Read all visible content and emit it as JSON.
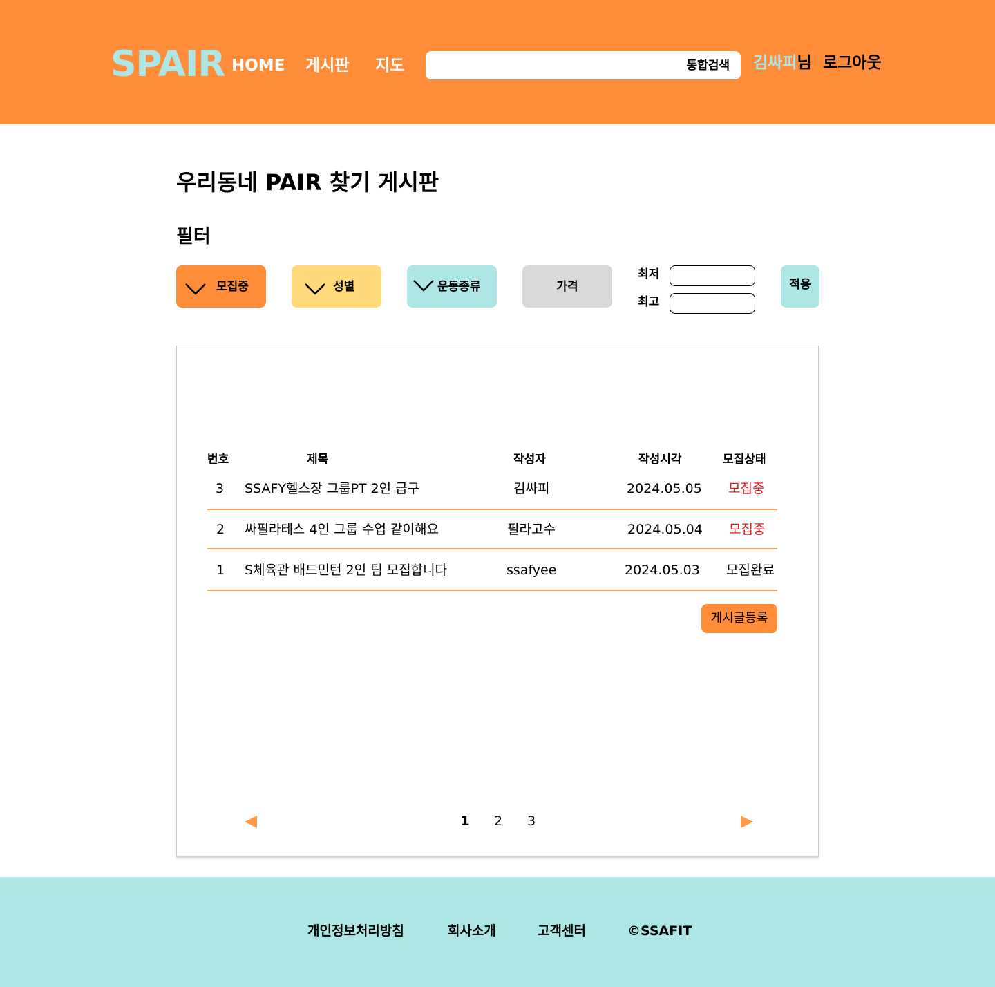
{
  "header": {
    "logo": "SPAIR",
    "nav": {
      "home": "HOME",
      "board": "게시판",
      "map": "지도"
    },
    "search": {
      "value": "",
      "button_label": "통합검색"
    },
    "user": {
      "name": "김싸피",
      "suffix": "님"
    },
    "logout": "로그아웃"
  },
  "page_title": "우리동네 PAIR 찾기 게시판",
  "filter": {
    "title": "필터",
    "recruit_label": "모집중",
    "gender_label": "성별",
    "sport_label": "운동종류",
    "price_label": "가격",
    "min_label": "최저",
    "max_label": "최고",
    "min_value": "",
    "max_value": "",
    "apply_label": "적용"
  },
  "table": {
    "headers": {
      "no": "번호",
      "title": "제목",
      "author": "작성자",
      "time": "작성시각",
      "status": "모집상태"
    },
    "rows": [
      {
        "no": "3",
        "title": "SSAFY헬스장 그룹PT 2인 급구",
        "author": "김싸피",
        "time": "2024.05.05",
        "status": "모집중"
      },
      {
        "no": "2",
        "title": "싸필라테스 4인 그룹 수업 같이해요",
        "author": "필라고수",
        "time": "2024.05.04",
        "status": "모집중"
      },
      {
        "no": "1",
        "title": "S체육관 배드민턴 2인 팀 모집합니다",
        "author": "ssafyee",
        "time": "2024.05.03",
        "status": "모집완료"
      }
    ]
  },
  "write_button": "게시글등록",
  "pagination": {
    "pages": [
      "1",
      "2",
      "3"
    ],
    "current": "1"
  },
  "footer": {
    "privacy": "개인정보처리방침",
    "about": "회사소개",
    "support": "고객센터",
    "copyright": "©SSAFIT"
  },
  "colors": {
    "primary": "#ff8c38",
    "mint": "#aee5e5",
    "yellow": "#ffd97a",
    "gray": "#d9d9d9",
    "status_open": "#e01b1b"
  }
}
